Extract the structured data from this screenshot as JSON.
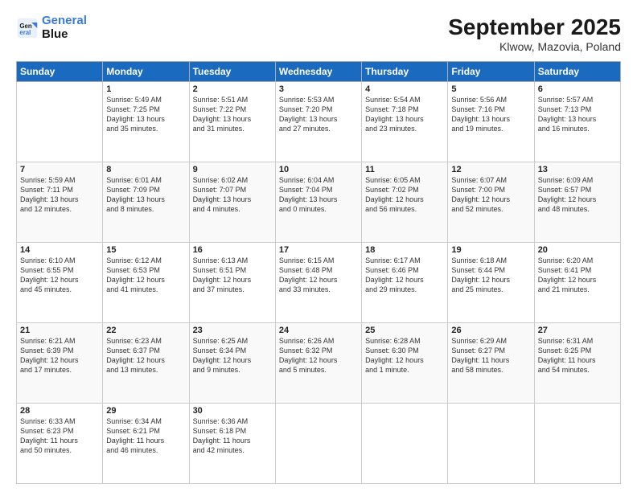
{
  "header": {
    "logo_line1": "General",
    "logo_line2": "Blue",
    "month": "September 2025",
    "location": "Klwow, Mazovia, Poland"
  },
  "weekdays": [
    "Sunday",
    "Monday",
    "Tuesday",
    "Wednesday",
    "Thursday",
    "Friday",
    "Saturday"
  ],
  "weeks": [
    [
      {
        "day": "",
        "info": ""
      },
      {
        "day": "1",
        "info": "Sunrise: 5:49 AM\nSunset: 7:25 PM\nDaylight: 13 hours\nand 35 minutes."
      },
      {
        "day": "2",
        "info": "Sunrise: 5:51 AM\nSunset: 7:22 PM\nDaylight: 13 hours\nand 31 minutes."
      },
      {
        "day": "3",
        "info": "Sunrise: 5:53 AM\nSunset: 7:20 PM\nDaylight: 13 hours\nand 27 minutes."
      },
      {
        "day": "4",
        "info": "Sunrise: 5:54 AM\nSunset: 7:18 PM\nDaylight: 13 hours\nand 23 minutes."
      },
      {
        "day": "5",
        "info": "Sunrise: 5:56 AM\nSunset: 7:16 PM\nDaylight: 13 hours\nand 19 minutes."
      },
      {
        "day": "6",
        "info": "Sunrise: 5:57 AM\nSunset: 7:13 PM\nDaylight: 13 hours\nand 16 minutes."
      }
    ],
    [
      {
        "day": "7",
        "info": "Sunrise: 5:59 AM\nSunset: 7:11 PM\nDaylight: 13 hours\nand 12 minutes."
      },
      {
        "day": "8",
        "info": "Sunrise: 6:01 AM\nSunset: 7:09 PM\nDaylight: 13 hours\nand 8 minutes."
      },
      {
        "day": "9",
        "info": "Sunrise: 6:02 AM\nSunset: 7:07 PM\nDaylight: 13 hours\nand 4 minutes."
      },
      {
        "day": "10",
        "info": "Sunrise: 6:04 AM\nSunset: 7:04 PM\nDaylight: 13 hours\nand 0 minutes."
      },
      {
        "day": "11",
        "info": "Sunrise: 6:05 AM\nSunset: 7:02 PM\nDaylight: 12 hours\nand 56 minutes."
      },
      {
        "day": "12",
        "info": "Sunrise: 6:07 AM\nSunset: 7:00 PM\nDaylight: 12 hours\nand 52 minutes."
      },
      {
        "day": "13",
        "info": "Sunrise: 6:09 AM\nSunset: 6:57 PM\nDaylight: 12 hours\nand 48 minutes."
      }
    ],
    [
      {
        "day": "14",
        "info": "Sunrise: 6:10 AM\nSunset: 6:55 PM\nDaylight: 12 hours\nand 45 minutes."
      },
      {
        "day": "15",
        "info": "Sunrise: 6:12 AM\nSunset: 6:53 PM\nDaylight: 12 hours\nand 41 minutes."
      },
      {
        "day": "16",
        "info": "Sunrise: 6:13 AM\nSunset: 6:51 PM\nDaylight: 12 hours\nand 37 minutes."
      },
      {
        "day": "17",
        "info": "Sunrise: 6:15 AM\nSunset: 6:48 PM\nDaylight: 12 hours\nand 33 minutes."
      },
      {
        "day": "18",
        "info": "Sunrise: 6:17 AM\nSunset: 6:46 PM\nDaylight: 12 hours\nand 29 minutes."
      },
      {
        "day": "19",
        "info": "Sunrise: 6:18 AM\nSunset: 6:44 PM\nDaylight: 12 hours\nand 25 minutes."
      },
      {
        "day": "20",
        "info": "Sunrise: 6:20 AM\nSunset: 6:41 PM\nDaylight: 12 hours\nand 21 minutes."
      }
    ],
    [
      {
        "day": "21",
        "info": "Sunrise: 6:21 AM\nSunset: 6:39 PM\nDaylight: 12 hours\nand 17 minutes."
      },
      {
        "day": "22",
        "info": "Sunrise: 6:23 AM\nSunset: 6:37 PM\nDaylight: 12 hours\nand 13 minutes."
      },
      {
        "day": "23",
        "info": "Sunrise: 6:25 AM\nSunset: 6:34 PM\nDaylight: 12 hours\nand 9 minutes."
      },
      {
        "day": "24",
        "info": "Sunrise: 6:26 AM\nSunset: 6:32 PM\nDaylight: 12 hours\nand 5 minutes."
      },
      {
        "day": "25",
        "info": "Sunrise: 6:28 AM\nSunset: 6:30 PM\nDaylight: 12 hours\nand 1 minute."
      },
      {
        "day": "26",
        "info": "Sunrise: 6:29 AM\nSunset: 6:27 PM\nDaylight: 11 hours\nand 58 minutes."
      },
      {
        "day": "27",
        "info": "Sunrise: 6:31 AM\nSunset: 6:25 PM\nDaylight: 11 hours\nand 54 minutes."
      }
    ],
    [
      {
        "day": "28",
        "info": "Sunrise: 6:33 AM\nSunset: 6:23 PM\nDaylight: 11 hours\nand 50 minutes."
      },
      {
        "day": "29",
        "info": "Sunrise: 6:34 AM\nSunset: 6:21 PM\nDaylight: 11 hours\nand 46 minutes."
      },
      {
        "day": "30",
        "info": "Sunrise: 6:36 AM\nSunset: 6:18 PM\nDaylight: 11 hours\nand 42 minutes."
      },
      {
        "day": "",
        "info": ""
      },
      {
        "day": "",
        "info": ""
      },
      {
        "day": "",
        "info": ""
      },
      {
        "day": "",
        "info": ""
      }
    ]
  ]
}
